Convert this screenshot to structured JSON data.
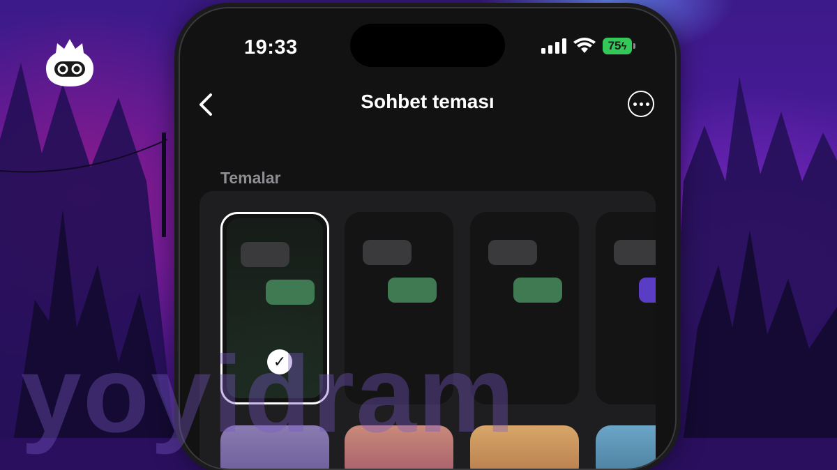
{
  "status_bar": {
    "time": "19:33",
    "battery": "75"
  },
  "nav": {
    "title": "Sohbet teması",
    "back_icon": "chevron-left-icon",
    "more_icon": "ellipsis-circle-icon"
  },
  "themes_section": {
    "label": "Temalar",
    "selected_index": 0
  },
  "colors": {
    "outgoing_bubble": "#3f7a52",
    "incoming_bubble": "#3a3a3c",
    "battery": "#34c759",
    "accent_purple": "#5b3cc4"
  },
  "watermark": "yoyidram"
}
